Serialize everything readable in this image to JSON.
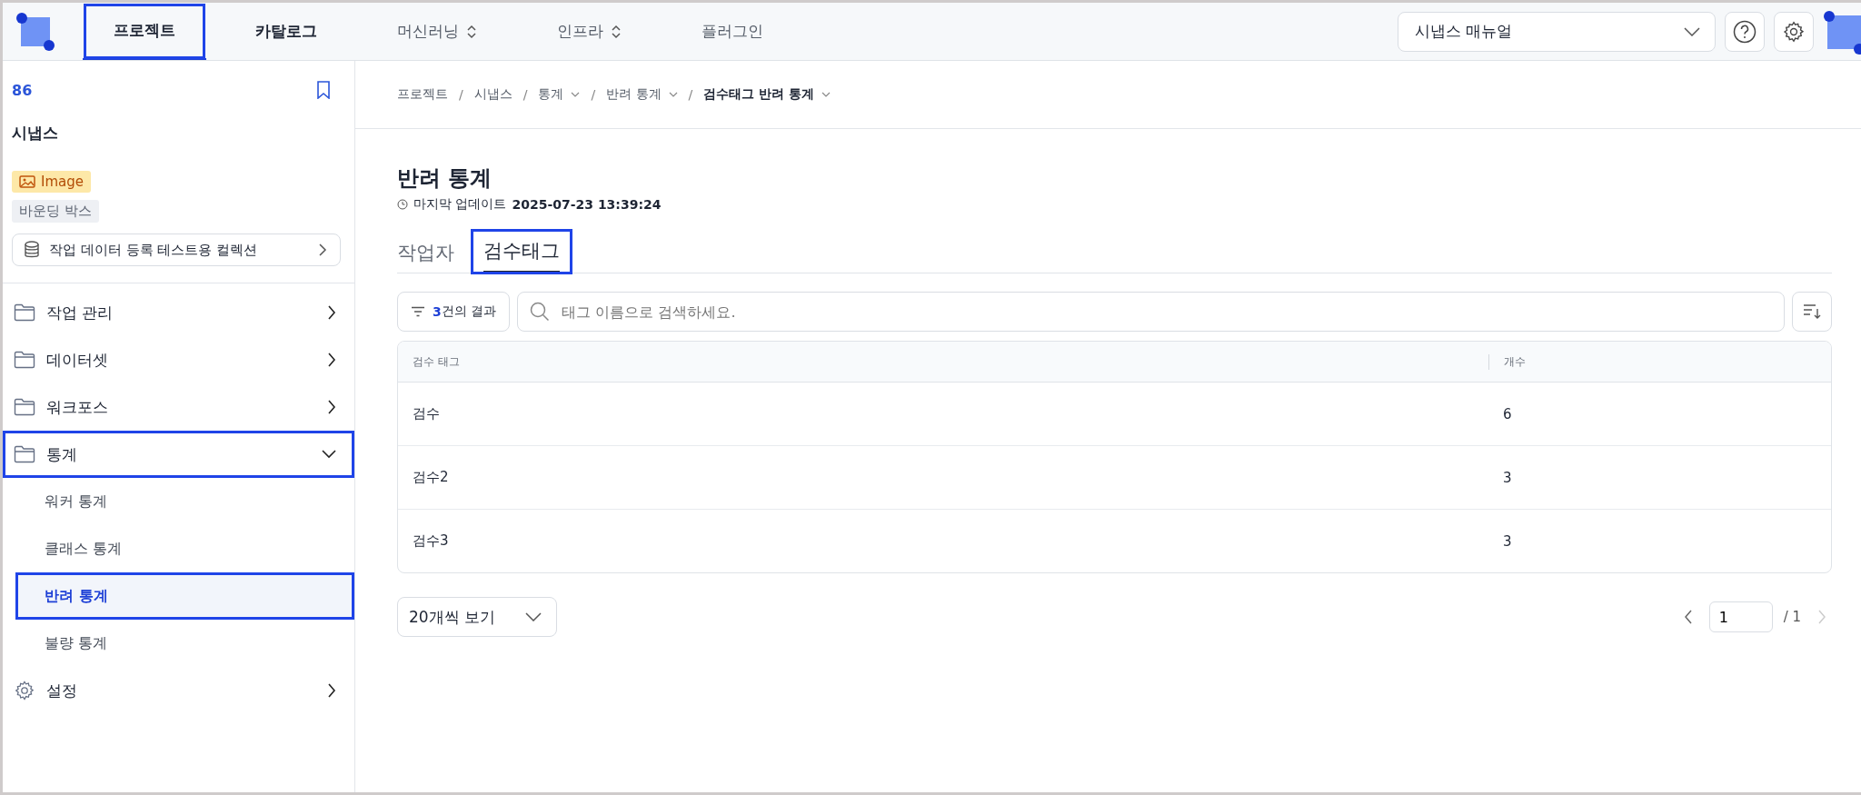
{
  "top_nav": {
    "items": [
      {
        "label": "프로젝트",
        "selected": true,
        "highlighted": true,
        "muted": false,
        "dropdown": false
      },
      {
        "label": "카탈로그",
        "selected": false,
        "highlighted": false,
        "muted": false,
        "dropdown": false
      },
      {
        "label": "머신러닝",
        "selected": false,
        "highlighted": false,
        "muted": true,
        "dropdown": true
      },
      {
        "label": "인프라",
        "selected": false,
        "highlighted": false,
        "muted": true,
        "dropdown": true
      },
      {
        "label": "플러그인",
        "selected": false,
        "highlighted": false,
        "muted": true,
        "dropdown": false
      }
    ],
    "manual_select": {
      "value": "시냅스 매뉴얼"
    }
  },
  "sidebar": {
    "project_id": "86",
    "project_name": "시냅스",
    "tags": [
      {
        "label": "Image",
        "kind": "image"
      },
      {
        "label": "바운딩 박스",
        "kind": "plain"
      }
    ],
    "collection": "작업 데이터 등록 테스트용 컬렉션",
    "menu": [
      {
        "label": "작업 관리",
        "kind": "folder",
        "expanded": false,
        "highlighted": false
      },
      {
        "label": "데이터셋",
        "kind": "folder",
        "expanded": false,
        "highlighted": false
      },
      {
        "label": "워크포스",
        "kind": "folder",
        "expanded": false,
        "highlighted": false
      },
      {
        "label": "통계",
        "kind": "folder",
        "expanded": true,
        "highlighted": true,
        "children": [
          {
            "label": "워커 통계",
            "selected": false,
            "highlighted": false
          },
          {
            "label": "클래스 통계",
            "selected": false,
            "highlighted": false
          },
          {
            "label": "반려 통계",
            "selected": true,
            "highlighted": true
          },
          {
            "label": "불량 통계",
            "selected": false,
            "highlighted": false
          }
        ]
      },
      {
        "label": "설정",
        "kind": "settings",
        "expanded": false,
        "highlighted": false
      }
    ]
  },
  "breadcrumb": [
    {
      "label": "프로젝트",
      "dropdown": false,
      "current": false
    },
    {
      "separator": "/",
      "label": "시냅스",
      "dropdown": false,
      "current": false
    },
    {
      "separator": "/",
      "label": "통계",
      "dropdown": true,
      "current": false
    },
    {
      "separator": "/",
      "label": "반려 통계",
      "dropdown": true,
      "current": false
    },
    {
      "separator": "/",
      "label": "검수태그 반려 통계",
      "dropdown": true,
      "current": true
    }
  ],
  "page": {
    "title": "반려 통계",
    "updated_label": "마지막 업데이트",
    "updated_value": "2025-07-23 13:39:24"
  },
  "tabs": [
    {
      "label": "작업자",
      "selected": false,
      "highlighted": false
    },
    {
      "label": "검수태그",
      "selected": true,
      "highlighted": true
    }
  ],
  "toolbar": {
    "result_count": "3",
    "result_suffix": "건의 결과",
    "search": {
      "placeholder": "태그 이름으로 검색하세요."
    }
  },
  "table": {
    "columns": [
      "검수 태그",
      "개수"
    ],
    "rows": [
      [
        "검수",
        "6"
      ],
      [
        "검수2",
        "3"
      ],
      [
        "검수3",
        "3"
      ]
    ]
  },
  "pagination": {
    "page_size": "20개씩 보기",
    "page": "1",
    "total": "/ 1",
    "prev_disabled": false,
    "next_disabled": true
  }
}
